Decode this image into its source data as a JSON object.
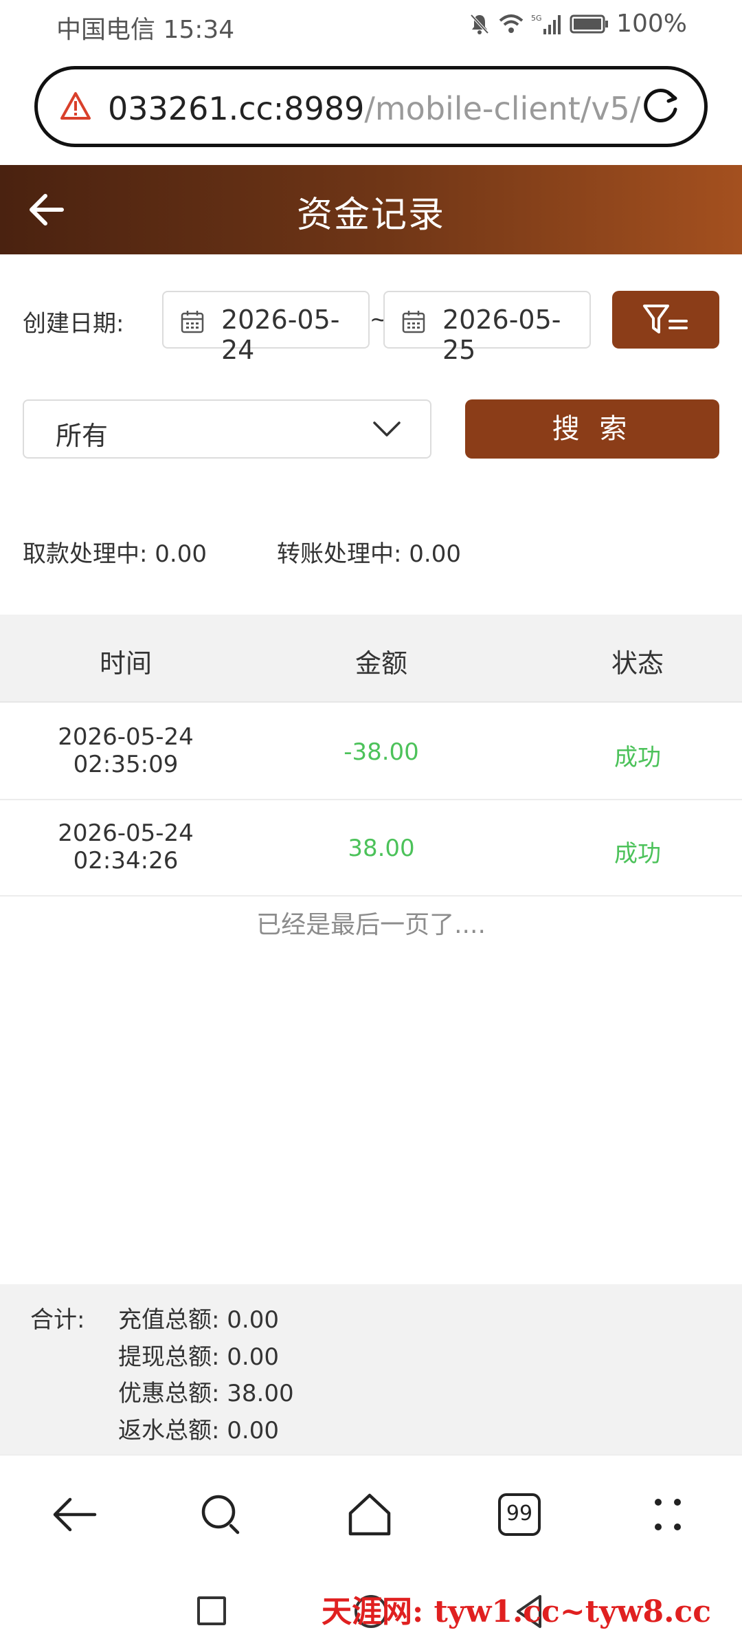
{
  "status_bar": {
    "carrier_time": "中国电信 15:34",
    "network": "5G",
    "battery": "100%"
  },
  "url_bar": {
    "host": "033261.cc:8989",
    "path": "/mobile-client/v5/"
  },
  "header": {
    "title": "资金记录"
  },
  "filters": {
    "date_label": "创建日期:",
    "start_date": "2026-05-24",
    "separator": "~",
    "end_date": "2026-05-25",
    "type_select": "所有",
    "search_label": "搜 索"
  },
  "pending": {
    "withdraw": "取款处理中:  0.00",
    "transfer": "转账处理中:  0.00"
  },
  "table": {
    "columns": [
      "时间",
      "金额",
      "状态"
    ],
    "rows": [
      {
        "date": "2026-05-24",
        "time": "02:35:09",
        "amount": "-38.00",
        "status": "成功"
      },
      {
        "date": "2026-05-24",
        "time": "02:34:26",
        "amount": "38.00",
        "status": "成功"
      }
    ],
    "end_note": "已经是最后一页了...."
  },
  "totals": {
    "label": "合计:",
    "recharge": "充值总额:  0.00",
    "withdraw": "提现总额:  0.00",
    "bonus": "优惠总额:  38.00",
    "rebate": "返水总额:  0.00"
  },
  "browser_nav": {
    "tab_count": "99"
  },
  "watermark": "天涯网: tyw1.cc~tyw8.cc",
  "colors": {
    "brand": "#8b3d18",
    "success": "#4cc25a"
  }
}
